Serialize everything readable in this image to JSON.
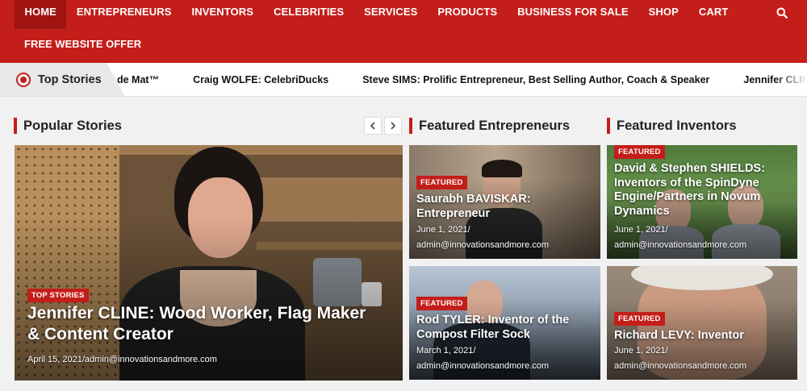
{
  "nav": {
    "items": [
      "HOME",
      "ENTREPRENEURS",
      "INVENTORS",
      "CELEBRITIES",
      "SERVICES",
      "PRODUCTS",
      "BUSINESS FOR SALE",
      "SHOP",
      "CART"
    ],
    "second_row": "FREE WEBSITE OFFER",
    "active": "HOME",
    "search_icon": "search-icon"
  },
  "ticker": {
    "label": "Top Stories",
    "items": [
      "de Mat™",
      "Craig WOLFE: CelebriDucks",
      "Steve SIMS: Prolific Entrepreneur, Best Selling Author, Coach & Speaker",
      "Jennifer CLINE: Wo"
    ]
  },
  "sections": {
    "popular": "Popular Stories",
    "entrepreneurs": "Featured Entrepreneurs",
    "inventors": "Featured Inventors"
  },
  "popular_card": {
    "badge": "TOP STORIES",
    "title": "Jennifer CLINE: Wood Worker, Flag Maker & Content Creator",
    "meta": "April 15, 2021/admin@innovationsandmore.com"
  },
  "entrepreneur_cards": [
    {
      "badge": "FEATURED",
      "title": "Saurabh BAVISKAR: Entrepreneur",
      "date": "June 1, 2021/",
      "author": "admin@innovationsandmore.com"
    },
    {
      "badge": "FEATURED",
      "title": "Rod TYLER: Inventor of the Compost Filter Sock",
      "date": "March 1, 2021/",
      "author": "admin@innovationsandmore.com"
    }
  ],
  "inventor_cards": [
    {
      "badge": "FEATURED",
      "title": "David & Stephen SHIELDS: Inventors of the SpinDyne Engine/Partners in Novum Dynamics",
      "date": "June 1, 2021/",
      "author": "admin@innovationsandmore.com"
    },
    {
      "badge": "FEATURED",
      "title": "Richard LEVY: Inventor",
      "date": "June 1, 2021/",
      "author": "admin@innovationsandmore.com"
    }
  ],
  "colors": {
    "brand_red": "#c41e1a",
    "nav_active": "#9f1411"
  }
}
